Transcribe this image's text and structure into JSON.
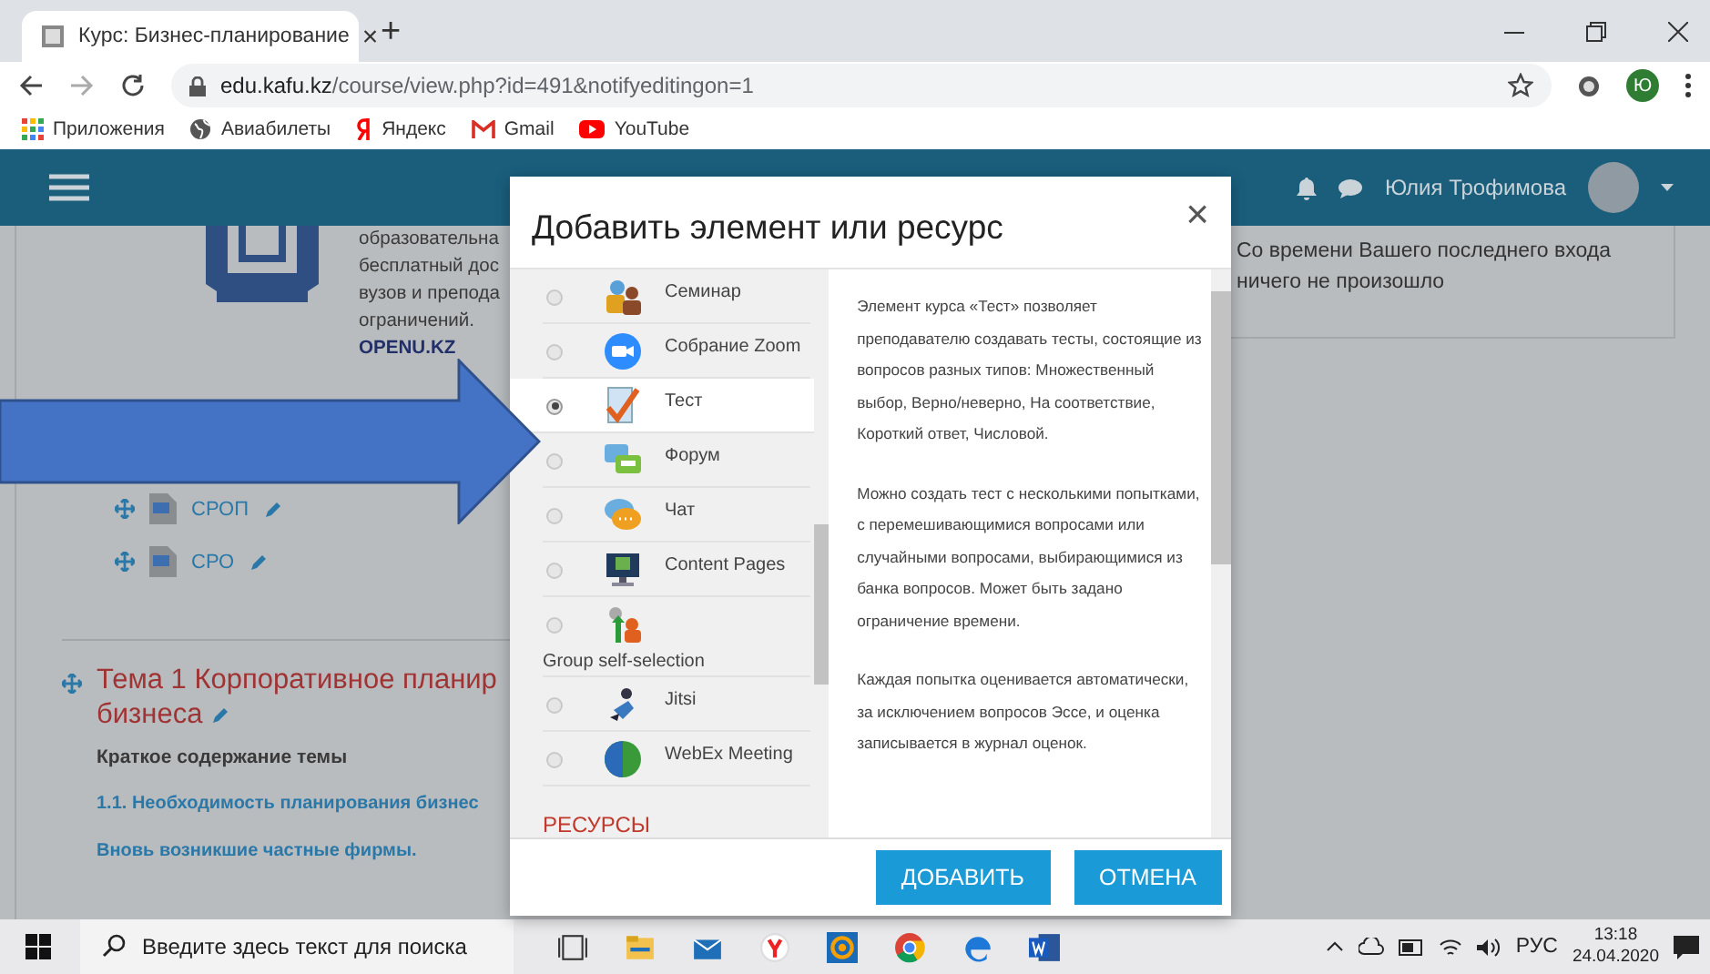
{
  "browser": {
    "tab": {
      "title": "Курс: Бизнес-планирование",
      "close": "×"
    },
    "new_tab": "+",
    "url_host": "edu.kafu.kz",
    "url_path": "/course/view.php?id=491&notifyeditingon=1",
    "profile": "Ю",
    "bookmarks": [
      {
        "label": "Приложения"
      },
      {
        "label": "Авиабилеты"
      },
      {
        "label": "Яндекс"
      },
      {
        "label": "Gmail"
      },
      {
        "label": "YouTube"
      }
    ]
  },
  "header": {
    "user": "Юлия Трофимова"
  },
  "course": {
    "intro_lines": [
      "образовательна",
      "бесплатный дос",
      "вузов и препода",
      "ограничений."
    ],
    "intro_link": "OPENU.KZ",
    "files": [
      {
        "label": "СРОП"
      },
      {
        "label": "СРО"
      }
    ],
    "topic": {
      "title_lines": [
        "Тема 1 Корпоративное планир",
        "бизнеса"
      ],
      "summary_heading": "Краткое содержание темы",
      "links": [
        "1.1. Необходимость планирования бизнес",
        "Вновь возникшие частные фирмы."
      ]
    },
    "recent_activity": "Со времени Вашего последнего входа ничего не произошло"
  },
  "modal": {
    "title": "Добавить элемент или ресурс",
    "close": "×",
    "items": [
      {
        "kind": "activity",
        "label": "Семинар",
        "selected": false
      },
      {
        "kind": "activity",
        "label": "Собрание Zoom",
        "selected": false
      },
      {
        "kind": "activity",
        "label": "Тест",
        "selected": true
      },
      {
        "kind": "activity",
        "label": "Форум",
        "selected": false
      },
      {
        "kind": "activity",
        "label": "Чат",
        "selected": false
      },
      {
        "kind": "activity",
        "label": "Content Pages",
        "selected": false
      },
      {
        "kind": "activity",
        "label": "Group self-selection",
        "selected": false
      },
      {
        "kind": "activity",
        "label": "Jitsi",
        "selected": false
      },
      {
        "kind": "activity",
        "label": "WebEx Meeting",
        "selected": false
      },
      {
        "kind": "section",
        "label": "РЕСУРСЫ"
      }
    ],
    "description": [
      "Элемент курса «Тест» позволяет преподавателю создавать тесты, состоящие из вопросов разных типов: Множественный выбор, Верно/неверно, На соответствие, Короткий ответ, Числовой.",
      "Можно создать тест с несколькими попытками, с перемешивающимися вопросами или случайными вопросами, выбирающимися из банка вопросов. Может быть задано ограничение времени.",
      "Каждая попытка оценивается автоматически, за исключением вопросов Эссе, и оценка записывается в журнал оценок."
    ],
    "buttons": [
      "ДОБАВИТЬ",
      "ОТМЕНА"
    ]
  },
  "taskbar": {
    "search_placeholder": "Введите здесь текст для поиска",
    "language": "РУС",
    "time": "13:18",
    "date": "24.04.2020"
  }
}
